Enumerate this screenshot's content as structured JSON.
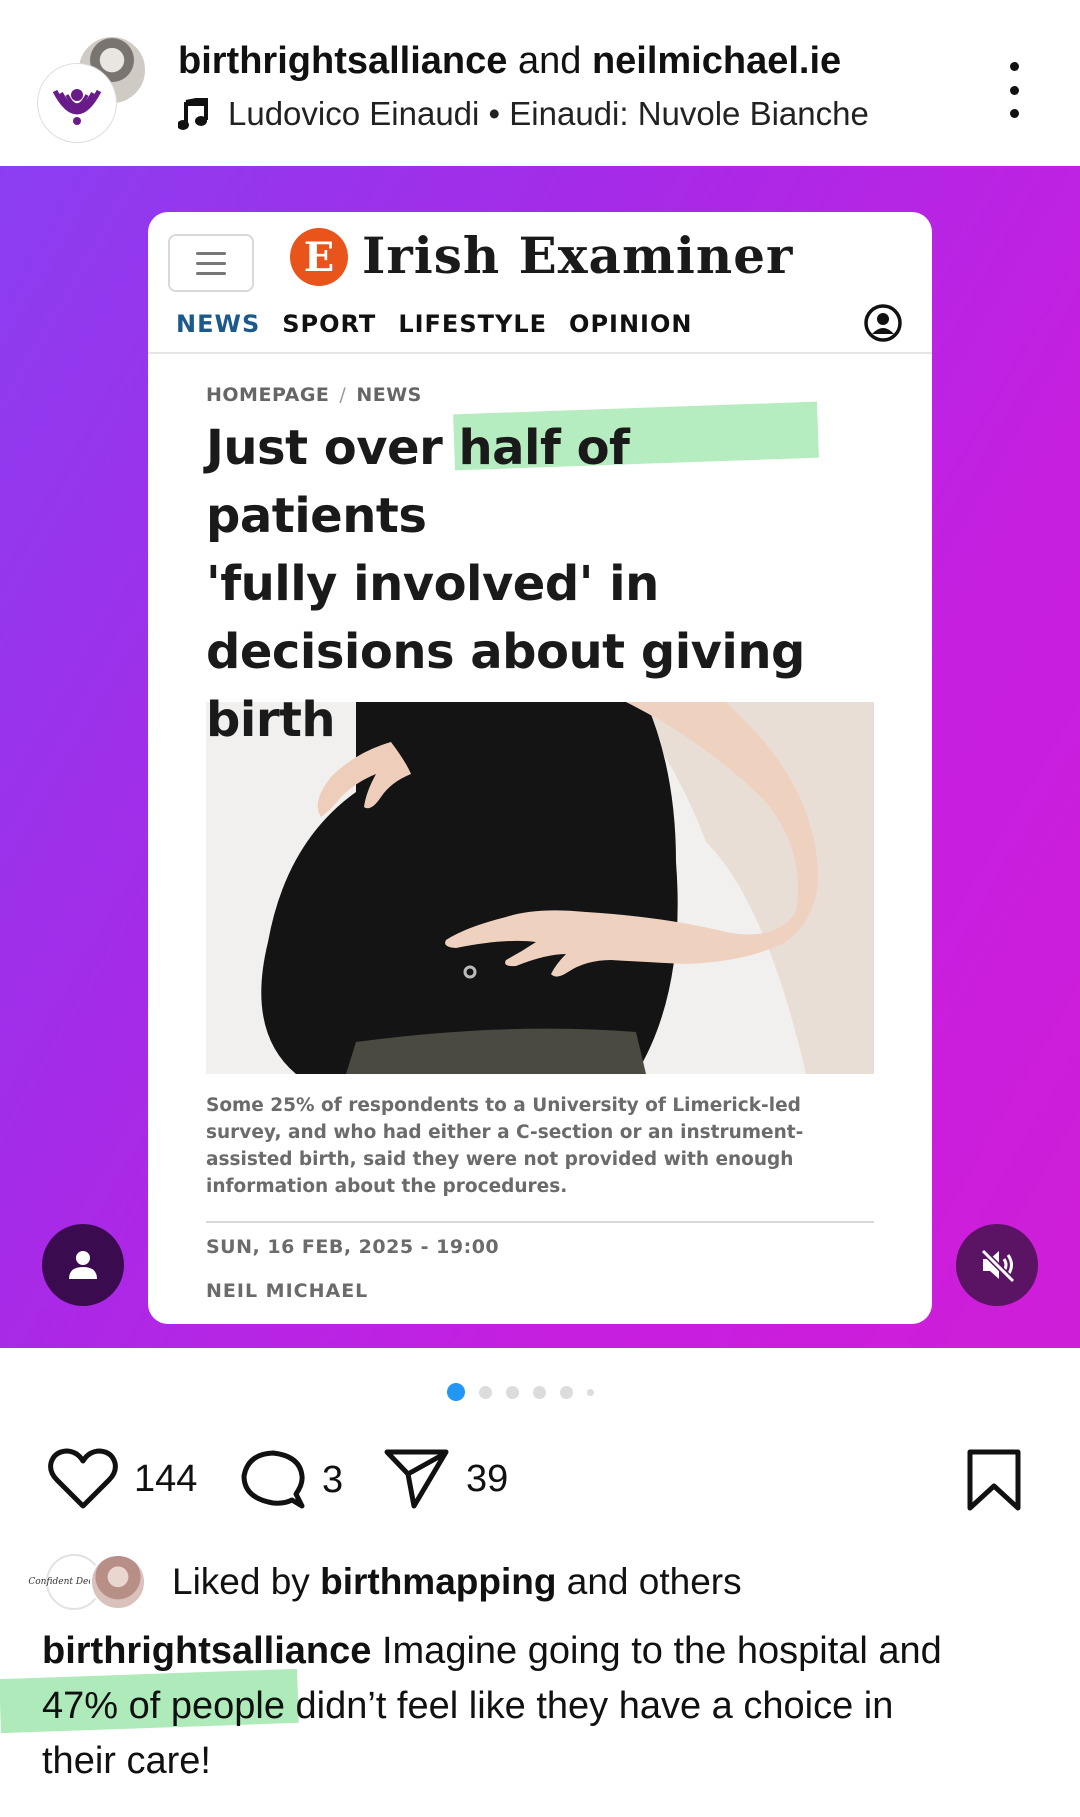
{
  "header": {
    "account1": "birthrightsalliance",
    "connector": "and",
    "account2": "neilmichael.ie",
    "music_artist": "Ludovico Einaudi",
    "music_sep": "•",
    "music_track": "Einaudi: Nuvole Bianche",
    "more_icon": "more-vertical-icon"
  },
  "article": {
    "logo_letter": "E",
    "logo_text": "Irish Examiner",
    "nav": [
      "NEWS",
      "SPORT",
      "LIFESTYLE",
      "OPINION"
    ],
    "breadcrumb_home": "HOMEPAGE",
    "breadcrumb_sep": "/",
    "breadcrumb_section": "NEWS",
    "headline_line1": "Just over half of patients",
    "headline_line2": "'fully involved' in",
    "headline_line3": "decisions about giving",
    "headline_line4": "birth",
    "caption": "Some 25% of respondents to a University of Limerick-led survey, and who had either a C-section or an instrument-assisted birth, said they were not provided with enough information about the procedures.",
    "date": "SUN, 16 FEB, 2025 - 19:00",
    "author": "NEIL MICHAEL"
  },
  "carousel": {
    "total": 6,
    "active": 1
  },
  "actions": {
    "likes": "144",
    "comments": "3",
    "shares": "39"
  },
  "liked_by": {
    "prefix": "Liked by",
    "user": "birthmapping",
    "suffix": "and others",
    "avatar_text": "Confident Decisions"
  },
  "post_caption": {
    "user": "birthrightsalliance",
    "text_line1": "Imagine going to the hospital and",
    "text_line2": "47% of people didn’t feel like they have a choice in",
    "text_line3": "their care!"
  },
  "colors": {
    "gradient_start": "#8b3ef0",
    "gradient_end": "#cf1ed8",
    "highlight": "#78dc8c",
    "nav_active": "#1d5a8c",
    "logo": "#e8541a",
    "dot_active": "#2196f3"
  }
}
